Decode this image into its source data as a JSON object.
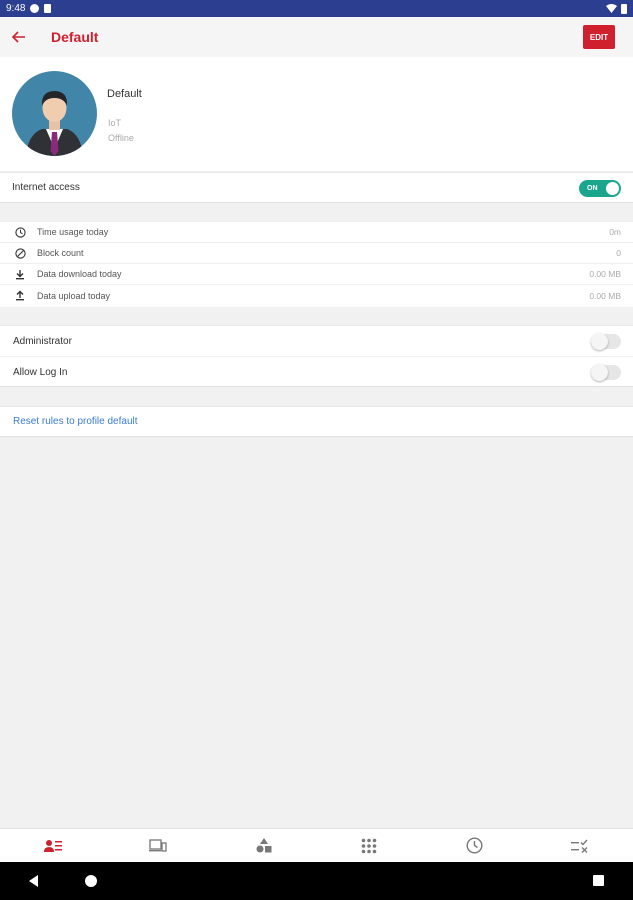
{
  "statusbar": {
    "time": "9:48"
  },
  "appbar": {
    "title": "Default",
    "edit_label": "EDIT"
  },
  "profile": {
    "name": "Default",
    "type": "IoT",
    "status": "Offline"
  },
  "internet": {
    "label": "Internet access",
    "toggle_label": "ON",
    "enabled": true
  },
  "stats": [
    {
      "icon": "clock-icon",
      "label": "Time usage today",
      "value": "0m"
    },
    {
      "icon": "block-icon",
      "label": "Block count",
      "value": "0"
    },
    {
      "icon": "download-icon",
      "label": "Data download today",
      "value": "0.00 MB"
    },
    {
      "icon": "upload-icon",
      "label": "Data upload today",
      "value": "0.00 MB"
    }
  ],
  "settings": [
    {
      "label": "Administrator",
      "enabled": false
    },
    {
      "label": "Allow Log In",
      "enabled": false
    }
  ],
  "reset": {
    "label": "Reset rules to profile default"
  },
  "bottom_nav": [
    {
      "icon": "profile-icon",
      "active": true
    },
    {
      "icon": "devices-icon",
      "active": false
    },
    {
      "icon": "categories-icon",
      "active": false
    },
    {
      "icon": "apps-grid-icon",
      "active": false
    },
    {
      "icon": "time-icon",
      "active": false
    },
    {
      "icon": "rules-icon",
      "active": false
    }
  ],
  "colors": {
    "accent": "#d0202e",
    "toggle_on": "#1aa68c",
    "link": "#3a7bd5",
    "statusbar": "#2c3e8f"
  }
}
